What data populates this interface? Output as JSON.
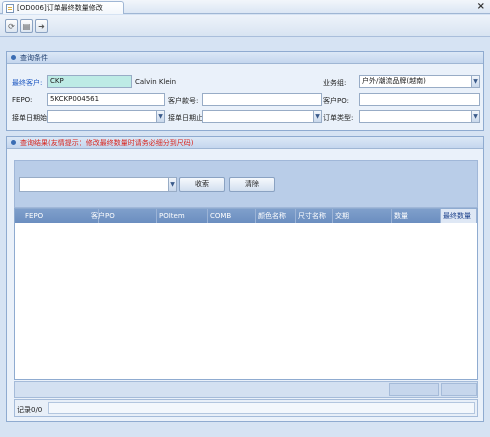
{
  "tab": {
    "title": "[OD006]订单最终数量修改"
  },
  "toolbar": {
    "icons": [
      "refresh-icon",
      "save-icon",
      "exit-icon"
    ]
  },
  "query": {
    "title": "查询条件",
    "final_customer_label": "最终客户:",
    "final_customer_code": "CKP",
    "final_customer_name": "Calvin Klein",
    "business_group_label": "业务组:",
    "business_group_value": "户外/潮流品牌(越南)",
    "fepo_label": "FEPO:",
    "fepo_value": "5KCKP004561",
    "style_no_label": "客户款号:",
    "style_no_value": "",
    "customer_po_label": "客户PO:",
    "customer_po_value": "",
    "order_date_start_label": "接单日期始:",
    "order_date_end_label": "接单日期止:",
    "order_type_label": "订单类型:"
  },
  "results": {
    "title": "查询结果(友情提示：修改最终数量时请务必细分到尺码)",
    "search_button": "收索",
    "clear_button": "清除",
    "columns": [
      "FEPO",
      "客户PO",
      "POItem",
      "COMB",
      "颜色名称",
      "尺寸名称",
      "交期",
      "数量",
      "最终数量"
    ],
    "records_label": "记录0/0"
  },
  "colors": {
    "header_blue": "#6b8ec0",
    "warning_red": "#d9241c",
    "final_customer_cyan": "#bdebe5"
  }
}
